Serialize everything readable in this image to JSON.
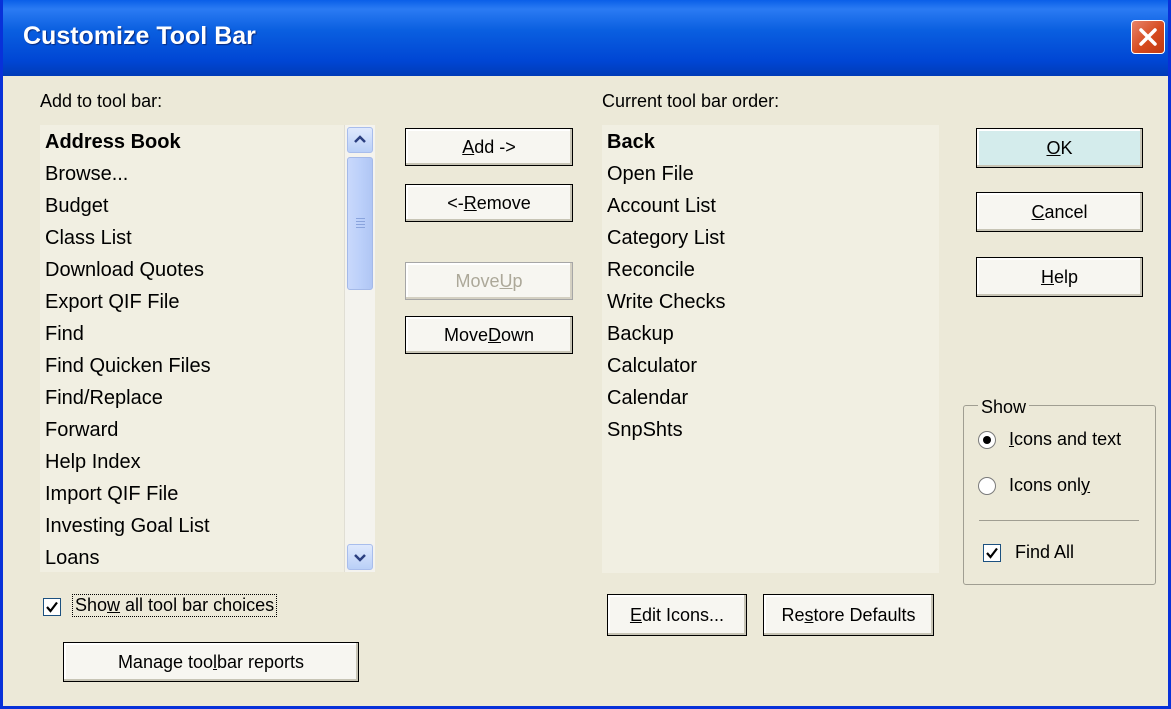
{
  "window": {
    "title": "Customize Tool Bar"
  },
  "left": {
    "label": "Add to tool bar:",
    "items": [
      "Address Book",
      "Browse...",
      "Budget",
      "Class List",
      "Download Quotes",
      "Export QIF File",
      "Find",
      "Find Quicken Files",
      "Find/Replace",
      "Forward",
      "Help Index",
      "Import QIF File",
      "Investing Goal List",
      "Loans"
    ]
  },
  "right": {
    "label": "Current tool bar order:",
    "items": [
      "Back",
      "Open File",
      "Account List",
      "Category List",
      "Reconcile",
      "Write Checks",
      "Backup",
      "Calculator",
      "Calendar",
      "SnpShts"
    ]
  },
  "buttons": {
    "add": {
      "pre": "",
      "key": "A",
      "post": "dd ->"
    },
    "remove": {
      "pre": "<- ",
      "key": "R",
      "post": "emove"
    },
    "move_up": {
      "pre": "Move ",
      "key": "U",
      "post": "p"
    },
    "move_down": {
      "pre": "Move ",
      "key": "D",
      "post": "own"
    },
    "ok": {
      "pre": "",
      "key": "O",
      "post": "K"
    },
    "cancel": {
      "pre": "",
      "key": "C",
      "post": "ancel"
    },
    "help": {
      "pre": "",
      "key": "H",
      "post": "elp"
    },
    "edit_icons": {
      "pre": "",
      "key": "E",
      "post": "dit Icons..."
    },
    "restore_defaults": {
      "pre": "Re",
      "key": "s",
      "post": "tore Defaults"
    },
    "manage_reports": {
      "pre": "Manage too",
      "key": "l",
      "post": "bar reports"
    }
  },
  "show_all": {
    "pre": "Sho",
    "key": "w",
    "post": " all tool bar choices",
    "checked": true
  },
  "show_group": {
    "title": "Show",
    "icons_and_text": {
      "pre": "",
      "key": "I",
      "post": "cons and text",
      "selected": true
    },
    "icons_only": {
      "pre": "Icons onl",
      "key": "y",
      "post": "",
      "selected": false
    },
    "find_all": {
      "label": "Find All",
      "checked": true
    }
  },
  "icons": {
    "close": "close-x-icon",
    "scroll_up": "chevron-up-icon",
    "scroll_down": "chevron-down-icon",
    "check": "check-icon"
  },
  "colors": {
    "titlebar": "#0a5fe0",
    "dialog_bg": "#ece9d8",
    "close": "#d64a1e"
  }
}
